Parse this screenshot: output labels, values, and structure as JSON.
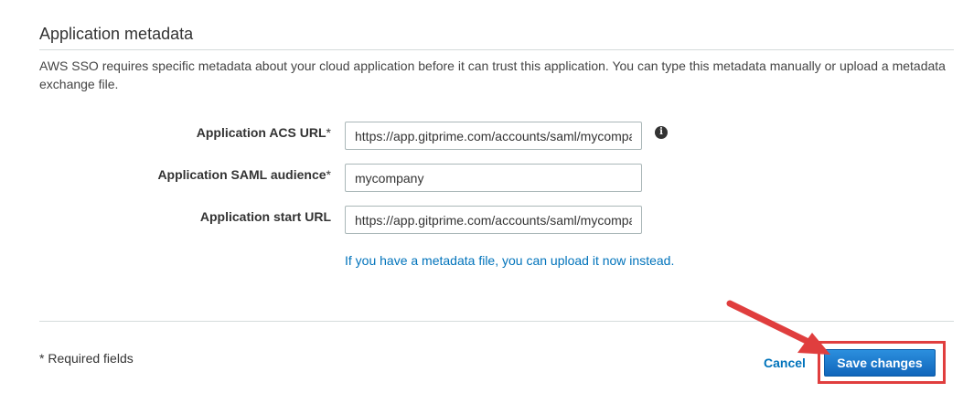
{
  "section": {
    "title": "Application metadata",
    "description": "AWS SSO requires specific metadata about your cloud application before it can trust this application. You can type this metadata manually or upload a metadata exchange file."
  },
  "fields": {
    "acs_url": {
      "label": "Application ACS URL",
      "required_mark": "*",
      "value": "https://app.gitprime.com/accounts/saml/mycompany/acs/"
    },
    "saml_audience": {
      "label": "Application SAML audience",
      "required_mark": "*",
      "value": "mycompany"
    },
    "start_url": {
      "label": "Application start URL",
      "value": "https://app.gitprime.com/accounts/saml/mycompany/"
    }
  },
  "info_icon": {
    "name": "info-icon",
    "glyph": "i"
  },
  "upload_link": "If you have a metadata file, you can upload it now instead.",
  "footer": {
    "required_note": "* Required fields",
    "cancel_label": "Cancel",
    "save_label": "Save changes"
  },
  "colors": {
    "link": "#0073bb",
    "primary_button": "#1a78c9",
    "annotation": "#e03e3e"
  }
}
